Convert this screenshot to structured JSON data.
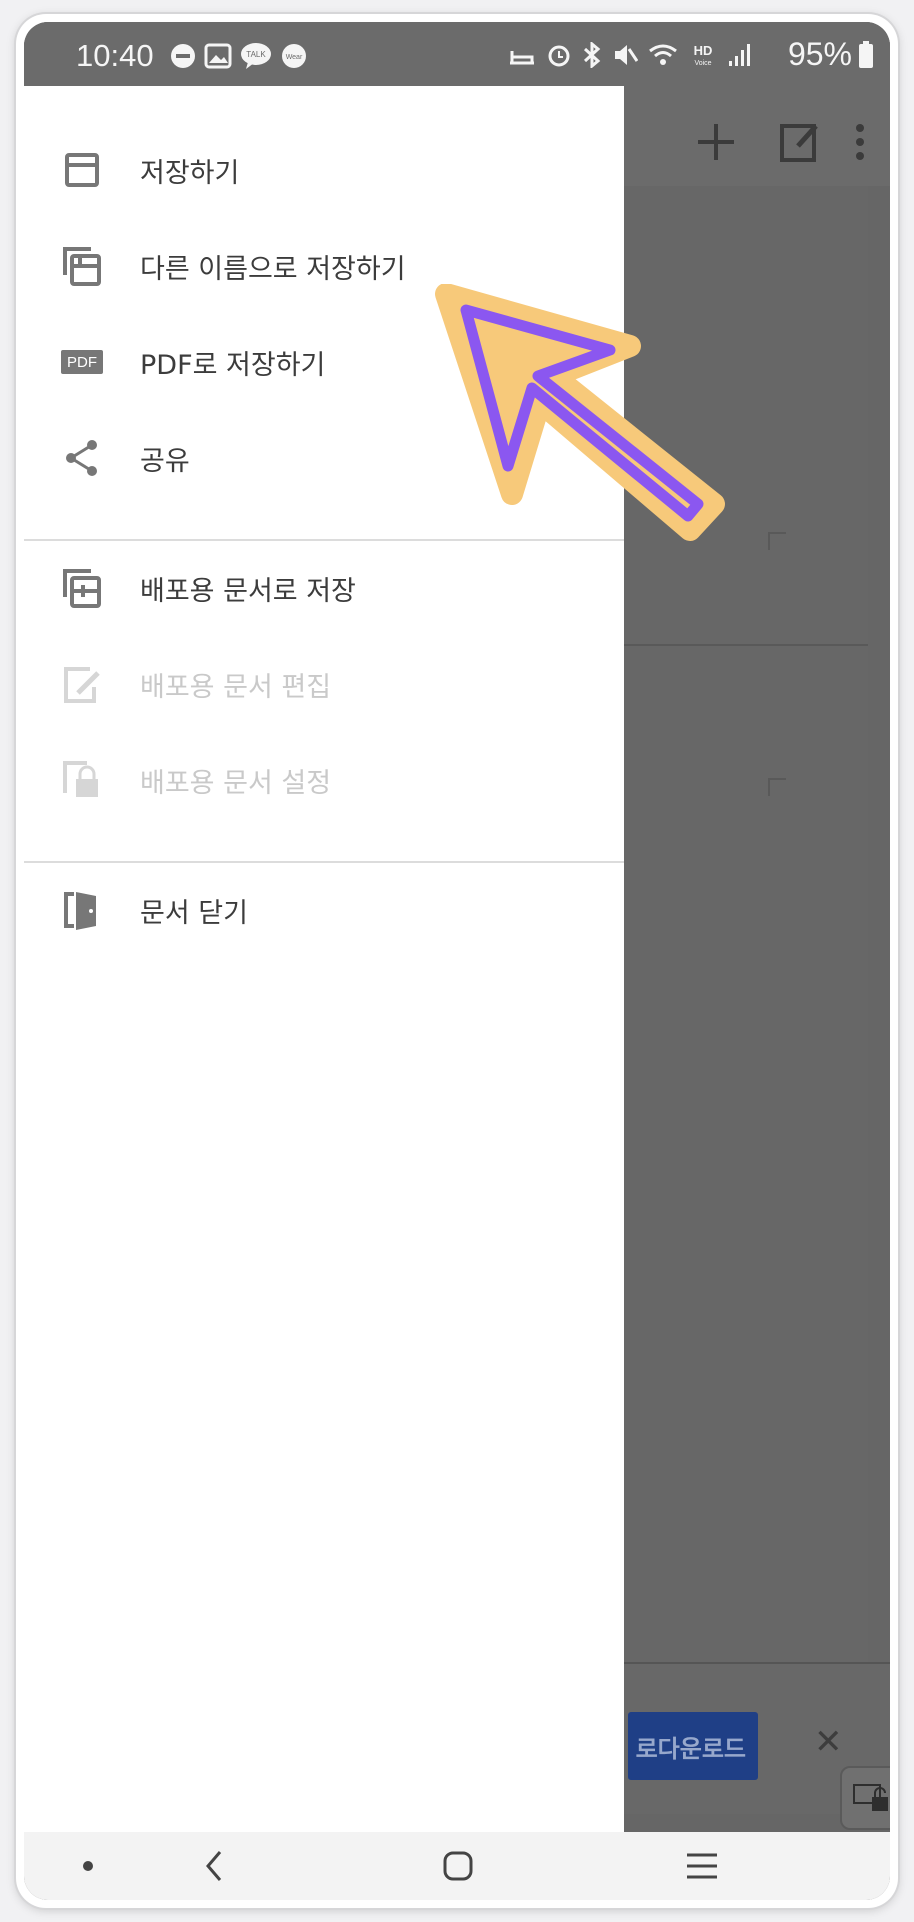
{
  "status_bar": {
    "time": "10:40",
    "battery_percent": "95%",
    "notification_icons": [
      "dnd-icon",
      "gallery-icon",
      "talk-icon",
      "wear-icon"
    ],
    "system_icons": [
      "sleep-icon",
      "alarm-icon",
      "bluetooth-icon",
      "mute-icon",
      "wifi-icon",
      "hd-voice-icon",
      "signal-icon"
    ]
  },
  "drawer": {
    "items": [
      {
        "label": "저장하기",
        "icon": "save-icon",
        "enabled": true
      },
      {
        "label": "다른 이름으로 저장하기",
        "icon": "save-as-icon",
        "enabled": true
      },
      {
        "label": "PDF로 저장하기",
        "icon": "pdf-icon",
        "badge": "PDF",
        "enabled": true
      },
      {
        "label": "공유",
        "icon": "share-icon",
        "enabled": true
      },
      {
        "label": "배포용 문서로 저장",
        "icon": "distribute-save-icon",
        "enabled": true
      },
      {
        "label": "배포용 문서 편집",
        "icon": "distribute-edit-icon",
        "enabled": false
      },
      {
        "label": "배포용 문서 설정",
        "icon": "distribute-lock-icon",
        "enabled": false
      },
      {
        "label": "문서 닫기",
        "icon": "close-document-icon",
        "enabled": true
      }
    ]
  },
  "background_app": {
    "download_button_label": "로다운로드",
    "toolbar_icons": [
      "add-icon",
      "edit-icon",
      "more-vertical-icon"
    ]
  },
  "annotation": {
    "arrow_fill": "#f7c97a",
    "arrow_outline": "#8b57f0",
    "points_to": "다른 이름으로 저장하기"
  },
  "navigation_bar": {
    "buttons": [
      "dot-icon",
      "back-icon",
      "home-icon",
      "recents-icon"
    ]
  },
  "colors": {
    "scrim": "#666666",
    "drawer_bg": "#ffffff",
    "text_primary": "#3c3c3c",
    "text_disabled": "#c9c9c9",
    "download_button": "#1f3f86"
  }
}
